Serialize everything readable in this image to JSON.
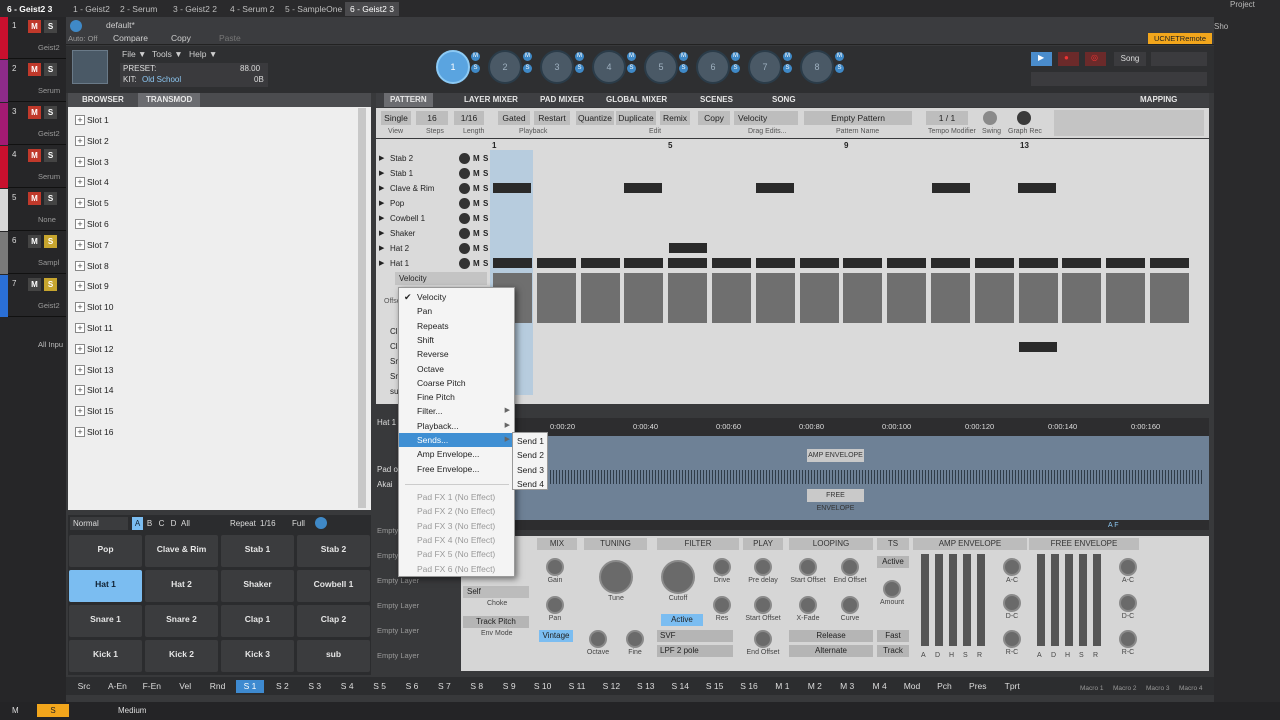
{
  "host": {
    "tabs": [
      "1 - Geist2",
      "2 - Serum",
      "3 - Geist2 2",
      "4 - Serum 2",
      "5 - SampleOne",
      "6 - Geist2 3"
    ],
    "active_tab": "6 - Geist2 3",
    "window_title": "6 - Geist2 3",
    "right_labels": [
      "Song",
      "UCNETRemote",
      "Project",
      "Sho"
    ],
    "auto_label": "Auto: Off",
    "compare": "Compare",
    "copy": "Copy",
    "paste": "Paste",
    "preset_default": "default*",
    "bottom_left": "M",
    "bottom_mid": "Medium",
    "status_s": "S"
  },
  "tracks": [
    {
      "num": "1",
      "name": "Geist2",
      "color": "#c8102e"
    },
    {
      "num": "2",
      "name": "Serum",
      "color": "#8e2b8a"
    },
    {
      "num": "3",
      "name": "Geist2",
      "color": "#a31a73"
    },
    {
      "num": "4",
      "name": "Serum",
      "color": "#c8102e"
    },
    {
      "num": "5",
      "name": "None",
      "color": "#d7d7d7"
    },
    {
      "num": "6",
      "name": "Sampl",
      "color": "#7a7a7a"
    },
    {
      "num": "7",
      "name": "Geist2",
      "color": "#2a6fd6"
    }
  ],
  "track_extra": "All Inpu",
  "plugin_header": {
    "menus": [
      "File ▼",
      "Tools ▼",
      "Help ▼"
    ],
    "preset_label": "PRESET:",
    "kit_label": "KIT:",
    "kit_value": "Old School",
    "bpm": "88.00",
    "ob": "0B",
    "pattern_pads": [
      "1",
      "2",
      "3",
      "4",
      "5",
      "6",
      "7",
      "8"
    ],
    "song_btn": "Song",
    "ms_m": "M",
    "ms_s": "S"
  },
  "left_panel": {
    "tabs": [
      "BROWSER",
      "TRANSMOD"
    ],
    "active": "TRANSMOD",
    "slots": [
      "Slot 1",
      "Slot 2",
      "Slot 3",
      "Slot 4",
      "Slot 5",
      "Slot 6",
      "Slot 7",
      "Slot 8",
      "Slot 9",
      "Slot 10",
      "Slot 11",
      "Slot 12",
      "Slot 13",
      "Slot 14",
      "Slot 15",
      "Slot 16"
    ]
  },
  "pad_bar": {
    "mode": "Normal",
    "banks": [
      "A",
      "B",
      "C",
      "D",
      "All"
    ],
    "repeat": "Repeat",
    "rate": "1/16",
    "full": "Full"
  },
  "pads": [
    "Pop",
    "Clave & Rim",
    "Stab 1",
    "Stab 2",
    "Hat 1",
    "Hat 2",
    "Shaker",
    "Cowbell 1",
    "Snare 1",
    "Snare 2",
    "Clap 1",
    "Clap 2",
    "Kick 1",
    "Kick 2",
    "Kick 3",
    "sub"
  ],
  "active_pad": "Hat 1",
  "right_tabs": [
    "PATTERN",
    "LAYER MIXER",
    "PAD MIXER",
    "GLOBAL MIXER",
    "SCENES",
    "SONG",
    "MAPPING"
  ],
  "active_right_tab": "PATTERN",
  "toolbar": {
    "single": "Single",
    "steps": "16",
    "length": "1/16",
    "gated": "Gated",
    "restart": "Restart",
    "quantize": "Quantize",
    "duplicate": "Duplicate",
    "remix": "Remix",
    "copy": "Copy",
    "velocity": "Velocity",
    "pattern_name": "Empty Pattern",
    "tempo_mod": "1 / 1",
    "labels": [
      "View",
      "Steps",
      "Length",
      "Playback",
      "Edit",
      "Drag Edits...",
      "Pattern Name",
      "Tempo Modifier",
      "Swing",
      "Graph Rec"
    ]
  },
  "bar_numbers": [
    "1",
    "5",
    "9",
    "13"
  ],
  "rows": [
    "Stab 2",
    "Stab 1",
    "Clave & Rim",
    "Pop",
    "Cowbell 1",
    "Shaker",
    "Hat 2",
    "Hat 1"
  ],
  "row_extra": [
    "Cl",
    "Cl",
    "Sn",
    "Sn",
    "su"
  ],
  "vel_select": "Velocity",
  "offset_lbl": "Offse",
  "dropdown": {
    "items": [
      "Velocity",
      "Pan",
      "Repeats",
      "Shift",
      "Reverse",
      "Octave",
      "Coarse Pitch",
      "Fine Pitch",
      "Filter...",
      "Playback...",
      "Sends...",
      "Amp Envelope...",
      "Free Envelope..."
    ],
    "disabled": [
      "Pad FX 1 (No Effect)",
      "Pad FX 2 (No Effect)",
      "Pad FX 3 (No Effect)",
      "Pad FX 4 (No Effect)",
      "Pad FX 5 (No Effect)",
      "Pad FX 6 (No Effect)"
    ],
    "checked": "Velocity",
    "highlighted": "Sends...",
    "submenu": [
      "Send 1",
      "Send 2",
      "Send 3",
      "Send 4"
    ]
  },
  "waveform": {
    "times": [
      "0:00:20",
      "0:00:40",
      "0:00:60",
      "0:00:80",
      "0:00:100",
      "0:00:120",
      "0:00:140",
      "0:00:160"
    ],
    "amp_env": "AMP ENVELOPE",
    "free_env": "FREE ENVELOPE",
    "track_lbl": "Hat 1",
    "pad_lbl": "Pad o",
    "akai_lbl": "Akai",
    "af": "A F"
  },
  "layers": [
    "Empty Layer",
    "Empty Layer",
    "Empty Layer",
    "Empty Layer",
    "Empty Layer",
    "Empty Layer",
    "Empty Layer"
  ],
  "editor": {
    "sections": [
      "MIX",
      "TUNING",
      "FILTER",
      "PLAY",
      "LOOPING",
      "TS",
      "AMP ENVELOPE",
      "FREE ENVELOPE"
    ],
    "mix": [
      "Gain",
      "Pan"
    ],
    "tune": "Tune",
    "octave": "Octave",
    "fine": "Fine",
    "vintage": "Vintage",
    "filter": [
      "Cutoff",
      "Drive",
      "Res"
    ],
    "filter_active": "Active",
    "svf": "SVF",
    "lpf": "LPF 2 pole",
    "play": [
      "Pre delay",
      "Start Offset",
      "End Offset"
    ],
    "looping": [
      "Start Offset",
      "End Offset",
      "X-Fade",
      "Curve"
    ],
    "release": "Release",
    "alternate": "Alternate",
    "ts": [
      "Active",
      "Amount",
      "Fast",
      "Track"
    ],
    "adhsr": [
      "A",
      "D",
      "H",
      "S",
      "R"
    ],
    "env_knobs": [
      "A-C",
      "D-C",
      "R-C"
    ],
    "self": "Self",
    "choke": "Choke",
    "track_pitch": "Track Pitch",
    "env_mode": "Env Mode"
  },
  "bottom": [
    "Src",
    "A-En",
    "F-En",
    "Vel",
    "Rnd",
    "S 1",
    "S 2",
    "S 3",
    "S 4",
    "S 5",
    "S 6",
    "S 7",
    "S 8",
    "S 9",
    "S 10",
    "S 11",
    "S 12",
    "S 13",
    "S 14",
    "S 15",
    "S 16",
    "M 1",
    "M 2",
    "M 3",
    "M 4",
    "Mod",
    "Pch",
    "Pres",
    "Tprt"
  ],
  "bottom_active": "S 1",
  "macros": [
    "Macro 1",
    "Macro 2",
    "Macro 3",
    "Macro 4"
  ]
}
